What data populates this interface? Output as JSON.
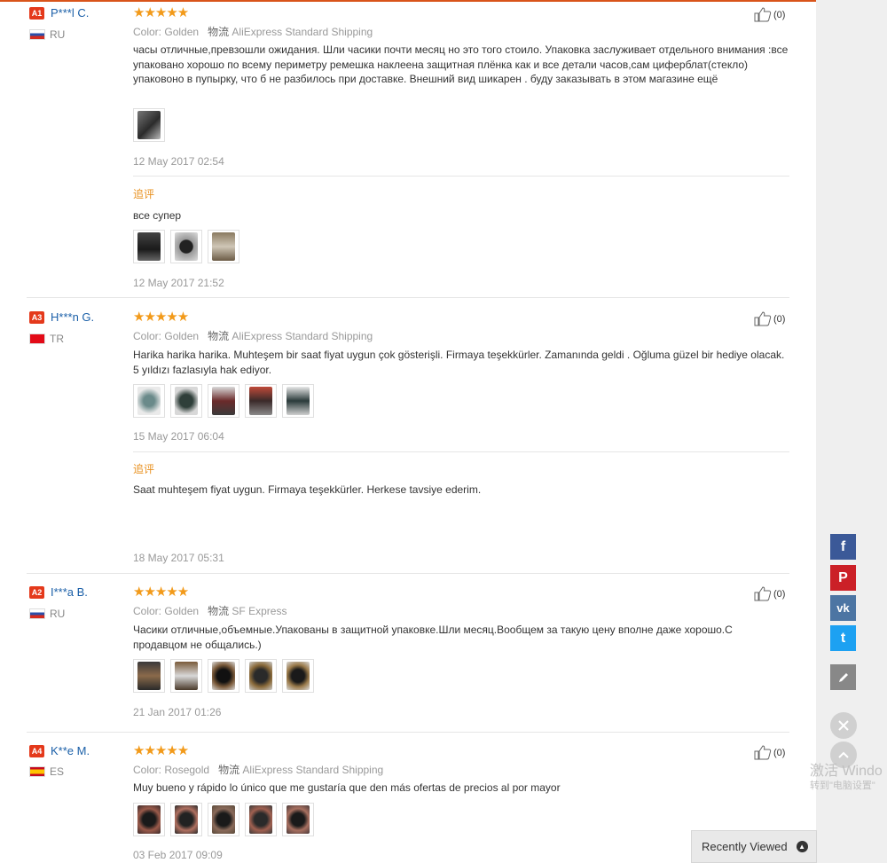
{
  "reviews": [
    {
      "badge": "A1",
      "user": "P***l C.",
      "country": "RU",
      "color_label": "Color:",
      "color": "Golden",
      "shipping_label": "物流",
      "shipping": "AliExpress Standard Shipping",
      "likes": "(0)",
      "text": "часы отличные,превзошли ожидания. Шли часики почти месяц но это того стоило. Упаковка заслуживает отдельного внимания :все упаковано хорошо по всему периметру ремешка наклеена защитная плёнка как и все детали часов,сам циферблат(стекло) упаковоно в пупырку, что б не разбилось при доставке. Внешний вид шикарен . буду заказывать в этом магазине ещё",
      "date": "12 May 2017 02:54",
      "followup_label": "追评",
      "followup_text": "все супер",
      "followup_date": "12 May 2017 21:52"
    },
    {
      "badge": "A3",
      "user": "H***n G.",
      "country": "TR",
      "color_label": "Color:",
      "color": "Golden",
      "shipping_label": "物流",
      "shipping": "AliExpress Standard Shipping",
      "likes": "(0)",
      "text": "Harika harika harika. Muhteşem bir saat fiyat uygun çok gösterişli. Firmaya teşekkürler. Zamanında geldi . Oğluma güzel bir hediye olacak. 5 yıldızı fazlasıyla hak ediyor.",
      "date": "15 May 2017 06:04",
      "followup_label": "追评",
      "followup_text": "Saat muhteşem fiyat uygun. Firmaya teşekkürler. Herkese tavsiye ederim.",
      "followup_date": "18 May 2017 05:31"
    },
    {
      "badge": "A2",
      "user": "I***a B.",
      "country": "RU",
      "color_label": "Color:",
      "color": "Golden",
      "shipping_label": "物流",
      "shipping": "SF Express",
      "likes": "(0)",
      "text": "Часики отличные,объемные.Упакованы в защитной упаковке.Шли месяц.Вообщем за такую цену вполне даже хорошо.С продавцом не общались.)",
      "date": "21 Jan 2017 01:26"
    },
    {
      "badge": "A4",
      "user": "K**e M.",
      "country": "ES",
      "color_label": "Color:",
      "color": "Rosegold",
      "shipping_label": "物流",
      "shipping": "AliExpress Standard Shipping",
      "likes": "(0)",
      "text": "Muy bueno y rápido lo único que me gustaría que den más ofertas de precios al por mayor",
      "date": "03 Feb 2017 09:09"
    }
  ],
  "stars_glyph": "★★★★★",
  "social": {
    "facebook": "f",
    "pinterest": "P",
    "vk": "vk",
    "twitter": "t"
  },
  "icons": {
    "edit": "edit-icon",
    "close": "close-icon",
    "up": "chevron-up-icon",
    "like": "thumbs-up-icon"
  },
  "colors": {
    "accent": "#e4391b",
    "star": "#f29a1a",
    "link": "#1a5fa8",
    "followup": "#e8901e"
  },
  "windows_watermark": {
    "line1": "激活 Windo",
    "line2": "转到\"电脑设置\""
  },
  "recently_viewed": "Recently Viewed"
}
